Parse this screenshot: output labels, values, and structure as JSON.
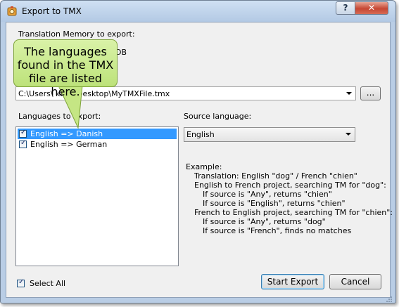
{
  "window": {
    "title": "Export to TMX",
    "help_label": "?",
    "close_label": "✕"
  },
  "tm_section": {
    "label": "Translation Memory to export:",
    "tm_partial": "DB"
  },
  "file": {
    "path": "C:\\Users\\         klein\\Desktop\\MyTMXFile.tmx",
    "browse_label": "..."
  },
  "languages": {
    "label": "Languages to export:",
    "items": [
      {
        "label": "English => Danish",
        "checked": true,
        "selected": true
      },
      {
        "label": "English => German",
        "checked": true,
        "selected": false
      }
    ]
  },
  "source": {
    "label": "Source language:",
    "value": "English"
  },
  "example": {
    "lines": [
      "Example:",
      "Translation: English \"dog\" / French \"chien\"",
      "English to French project, searching TM for \"dog\":",
      "If source is \"Any\", returns \"chien\"",
      "If source is \"English\", returns \"chien\"",
      "French to English project, searching TM for \"chien\":",
      "If source is \"Any\", returns \"dog\"",
      "If source is \"French\", finds no matches"
    ]
  },
  "footer": {
    "select_all_label": "Select All",
    "start_label": "Start Export",
    "cancel_label": "Cancel"
  },
  "callout": {
    "line1": "The languages",
    "line2": "found in the TMX",
    "line3": "file are listed here."
  },
  "colors": {
    "selection": "#3399ff",
    "callout_fill": "#c8e98a",
    "close_button": "#c64733"
  }
}
